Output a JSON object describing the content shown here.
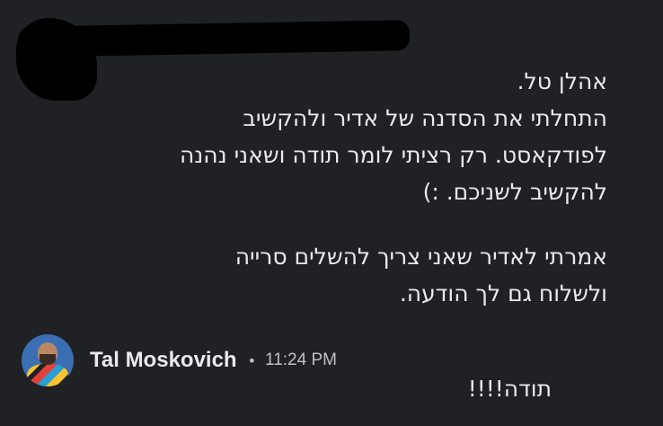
{
  "message": {
    "paragraph1": [
      "אהלן טל.",
      "התחלתי את הסדנה של אדיר ולהקשיב",
      "לפודקאסט. רק רציתי לומר תודה ושאני נהנה",
      "להקשיב לשניכם. :)"
    ],
    "paragraph2": [
      "אמרתי לאדיר שאני צריך להשלים סרייה",
      "ולשלוח גם לך הודעה."
    ]
  },
  "reply": {
    "author": "Tal Moskovich",
    "separator": "•",
    "time": "11:24 PM",
    "text": "תודה!!!!"
  },
  "colors": {
    "background": "#202124",
    "text": "#e8eaed",
    "muted": "#bdc1c6"
  }
}
